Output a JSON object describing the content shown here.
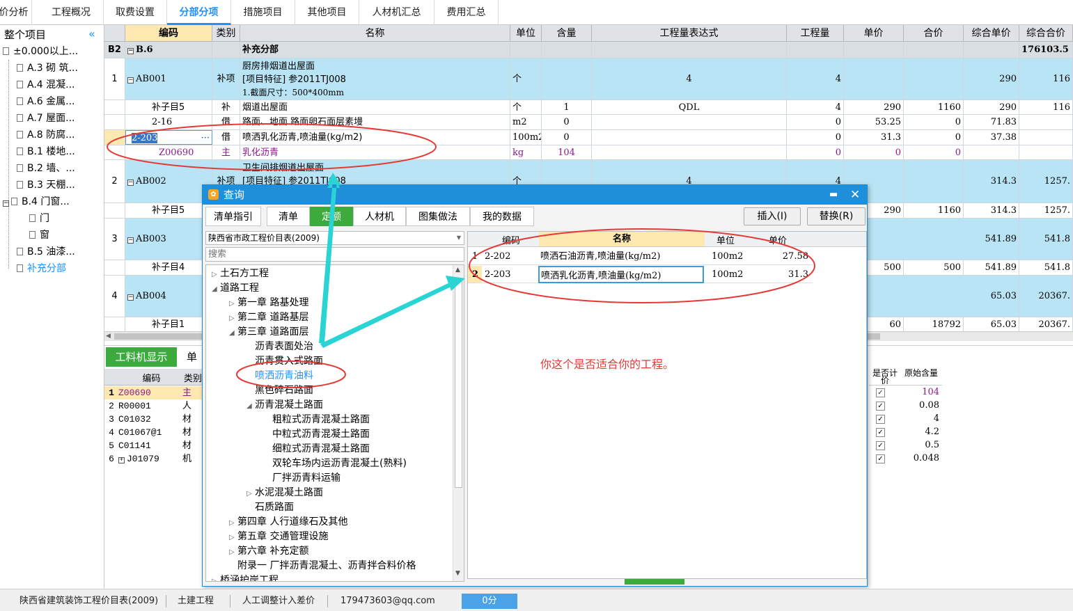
{
  "top_tabs": [
    "价分析",
    "工程概况",
    "取费设置",
    "分部分项",
    "措施项目",
    "其他项目",
    "人材机汇总",
    "费用汇总"
  ],
  "left_tree": {
    "title": "整个项目",
    "collapse_icon": "double-chevron-left-icon",
    "items": [
      "±0.000以上...",
      "A.3 砌 筑...",
      "A.4 混凝...",
      "A.6 金属...",
      "A.7 屋面...",
      "A.8 防腐...",
      "B.1 楼地...",
      "B.2 墙、...",
      "B.3 天棚...",
      "B.4 门窗...",
      "门",
      "窗",
      "B.5 油漆...",
      "补充分部"
    ]
  },
  "grid": {
    "headers": [
      "编码",
      "类别",
      "名称",
      "单位",
      "含量",
      "工程量表达式",
      "工程量",
      "单价",
      "合价",
      "综合单价",
      "综合合价"
    ],
    "section": {
      "no": "B2",
      "code": "B.6",
      "name": "补充分部",
      "total": "176103.5"
    },
    "rows": [
      {
        "no": "1",
        "code": "AB001",
        "type": "补项",
        "name1": "厨房排烟道出屋面",
        "name2": "[项目特征]  参2011TJ008",
        "name3": "1.截面尺寸：500*400mm",
        "unit": "个",
        "expr": "4",
        "qty": "4",
        "uprice": "290",
        "total": "116"
      },
      {
        "code": "补子目5",
        "type": "补",
        "name": "烟道出屋面",
        "unit": "个",
        "content": "1",
        "expr": "QDL",
        "qty": "4",
        "price": "290",
        "amount": "1160",
        "uprice": "290",
        "total": "116"
      },
      {
        "code": "2-16",
        "type": "借",
        "name": "路面、地面 路面卵石面层素墁",
        "unit": "m2",
        "content": "0",
        "qty": "0",
        "price": "53.25",
        "amount": "0",
        "uprice": "71.83"
      },
      {
        "code": "2-203",
        "type": "借",
        "name": "喷洒乳化沥青,喷油量(kg/m2)",
        "unit": "100m2",
        "content": "0",
        "qty": "0",
        "price": "31.3",
        "amount": "0",
        "uprice": "37.38",
        "ellipsis": "···"
      },
      {
        "code": "Z00690",
        "type": "主",
        "name": "乳化沥青",
        "unit": "kg",
        "content": "104",
        "qty": "0",
        "price": "0",
        "amount": "0"
      },
      {
        "no": "2",
        "code": "AB002",
        "type": "补项",
        "name1": "卫生间排烟道出屋面",
        "name2": "[项目特征]  参2011TJ008",
        "unit": "个",
        "expr": "4",
        "qty": "4",
        "uprice": "314.3",
        "total": "1257."
      },
      {
        "code": "补子目5",
        "price": "290",
        "amount": "1160",
        "uprice": "314.3",
        "total": "1257."
      },
      {
        "no": "3",
        "code": "AB003",
        "uprice": "541.89",
        "total": "541.8"
      },
      {
        "code": "补子目4",
        "price": "500",
        "amount": "500",
        "uprice": "541.89",
        "total": "541.8"
      },
      {
        "no": "4",
        "code": "AB004",
        "uprice": "65.03",
        "total": "20367."
      },
      {
        "code": "补子目1",
        "price": "60",
        "amount": "18792",
        "uprice": "65.03",
        "total": "20367."
      }
    ]
  },
  "bottom": {
    "tab": "工料机显示",
    "tab2": "单",
    "headers": [
      "编码",
      "类别"
    ],
    "right_headers": [
      "是否计价",
      "原始含量"
    ],
    "rows": [
      {
        "no": "1",
        "code": "Z00690",
        "type": "主",
        "orig": "104"
      },
      {
        "no": "2",
        "code": "R00001",
        "type": "人",
        "orig": "0.08"
      },
      {
        "no": "3",
        "code": "C01032",
        "type": "材",
        "orig": "4"
      },
      {
        "no": "4",
        "code": "C01067@1",
        "type": "材",
        "orig": "4.2"
      },
      {
        "no": "5",
        "code": "C01141",
        "type": "材",
        "orig": "0.5"
      },
      {
        "no": "6",
        "code": "J01079",
        "type": "机",
        "orig": "0.048"
      }
    ],
    "annotation": "你这个是否适合你的工程。"
  },
  "dialog": {
    "title": "查询",
    "tabs": [
      "清单指引",
      "清单",
      "定额",
      "人材机",
      "图集做法",
      "我的数据"
    ],
    "insert_label": "插入(I)",
    "replace_label": "替换(R)",
    "library": "陕西省市政工程价目表(2009)",
    "search_placeholder": "搜索",
    "tree": [
      "土石方工程",
      "道路工程",
      "第一章  路基处理",
      "第二章  道路基层",
      "第三章  道路面层",
      "沥青表面处治",
      "沥青贯入式路面",
      "喷洒沥青油料",
      "黑色碎石路面",
      "沥青混凝土路面",
      "粗粒式沥青混凝土路面",
      "中粒式沥青混凝土路面",
      "细粒式沥青混凝土路面",
      "双轮车场内运沥青混凝土(熟料)",
      "厂拌沥青料运输",
      "水泥混凝土路面",
      "石质路面",
      "第四章  人行道缘石及其他",
      "第五章  交通管理设施",
      "第六章  补充定额",
      "附录一  厂拌沥青混凝土、沥青拌合料价格",
      "桥涵护岸工程"
    ],
    "result_headers": [
      "编码",
      "名称",
      "单位",
      "单价"
    ],
    "results": [
      {
        "no": "1",
        "code": "2-202",
        "name": "喷洒石油沥青,喷油量(kg/m2)",
        "unit": "100m2",
        "price": "27.58"
      },
      {
        "no": "2",
        "code": "2-203",
        "name": "喷洒乳化沥青,喷油量(kg/m2)",
        "unit": "100m2",
        "price": "31.3"
      }
    ]
  },
  "status": [
    "陕西省建筑装饰工程价目表(2009)",
    "土建工程",
    "人工调整计入差价",
    "179473603@qq.com",
    "0分"
  ],
  "colors": {
    "accent": "#1e90ff",
    "row_blue": "#b9e4f5",
    "dialog_title": "#1e8fd8",
    "tab_green": "#3daa3d",
    "annotation_red": "#e53935",
    "arrow_cyan": "#2ad4d4"
  }
}
